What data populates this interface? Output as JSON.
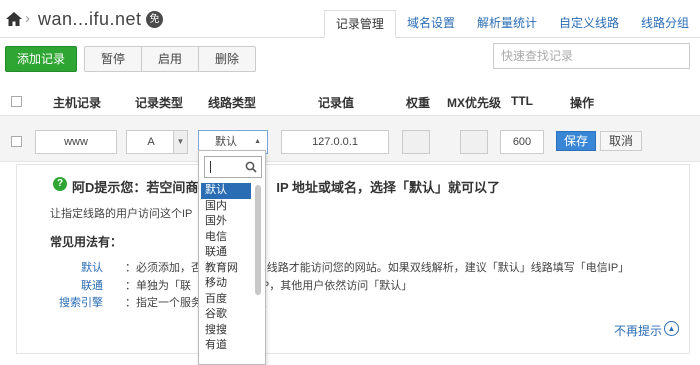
{
  "header": {
    "domain": "wan...ifu.net",
    "badge": "免",
    "tabs": [
      {
        "label": "记录管理"
      },
      {
        "label": "域名设置"
      },
      {
        "label": "解析量统计"
      },
      {
        "label": "自定义线路"
      },
      {
        "label": "线路分组"
      }
    ]
  },
  "toolbar": {
    "add_label": "添加记录",
    "pause_label": "暂停",
    "enable_label": "启用",
    "delete_label": "删除",
    "search_placeholder": "快速查找记录"
  },
  "table": {
    "columns": [
      "主机记录",
      "记录类型",
      "线路类型",
      "记录值",
      "权重",
      "MX优先级",
      "TTL",
      "操作"
    ]
  },
  "edit_row": {
    "host": "www",
    "type": "A",
    "line": "默认",
    "value": "127.0.0.1",
    "weight": "",
    "mx": "",
    "ttl": "600",
    "save_label": "保存",
    "cancel_label": "取消"
  },
  "tip": {
    "title": "阿D提示您：若空间商只                  IP 地址或域名，选择「默认」就可以了",
    "desc": "让指定线路的用户访问这个IP",
    "usage_title": "常见用法有：",
    "usages": [
      {
        "key": "默认",
        "value": "：必须添加，否              定的线路才能访问您的网站。如果双线解析，建议「默认」线路填写「电信IP」"
      },
      {
        "key": "联通",
        "value": "：单独为「联              务器 IP，其他用户依然访问「默认」"
      },
      {
        "key": "搜索引擎",
        "value": "：指定一个服务              抓取"
      }
    ],
    "no_tip_label": "不再提示"
  },
  "dropdown": {
    "search_value": "",
    "options": [
      "默认",
      "国内",
      "国外",
      "电信",
      "联通",
      "教育网",
      "移动",
      "百度",
      "谷歌",
      "搜搜",
      "有道"
    ],
    "selected": "默认"
  }
}
